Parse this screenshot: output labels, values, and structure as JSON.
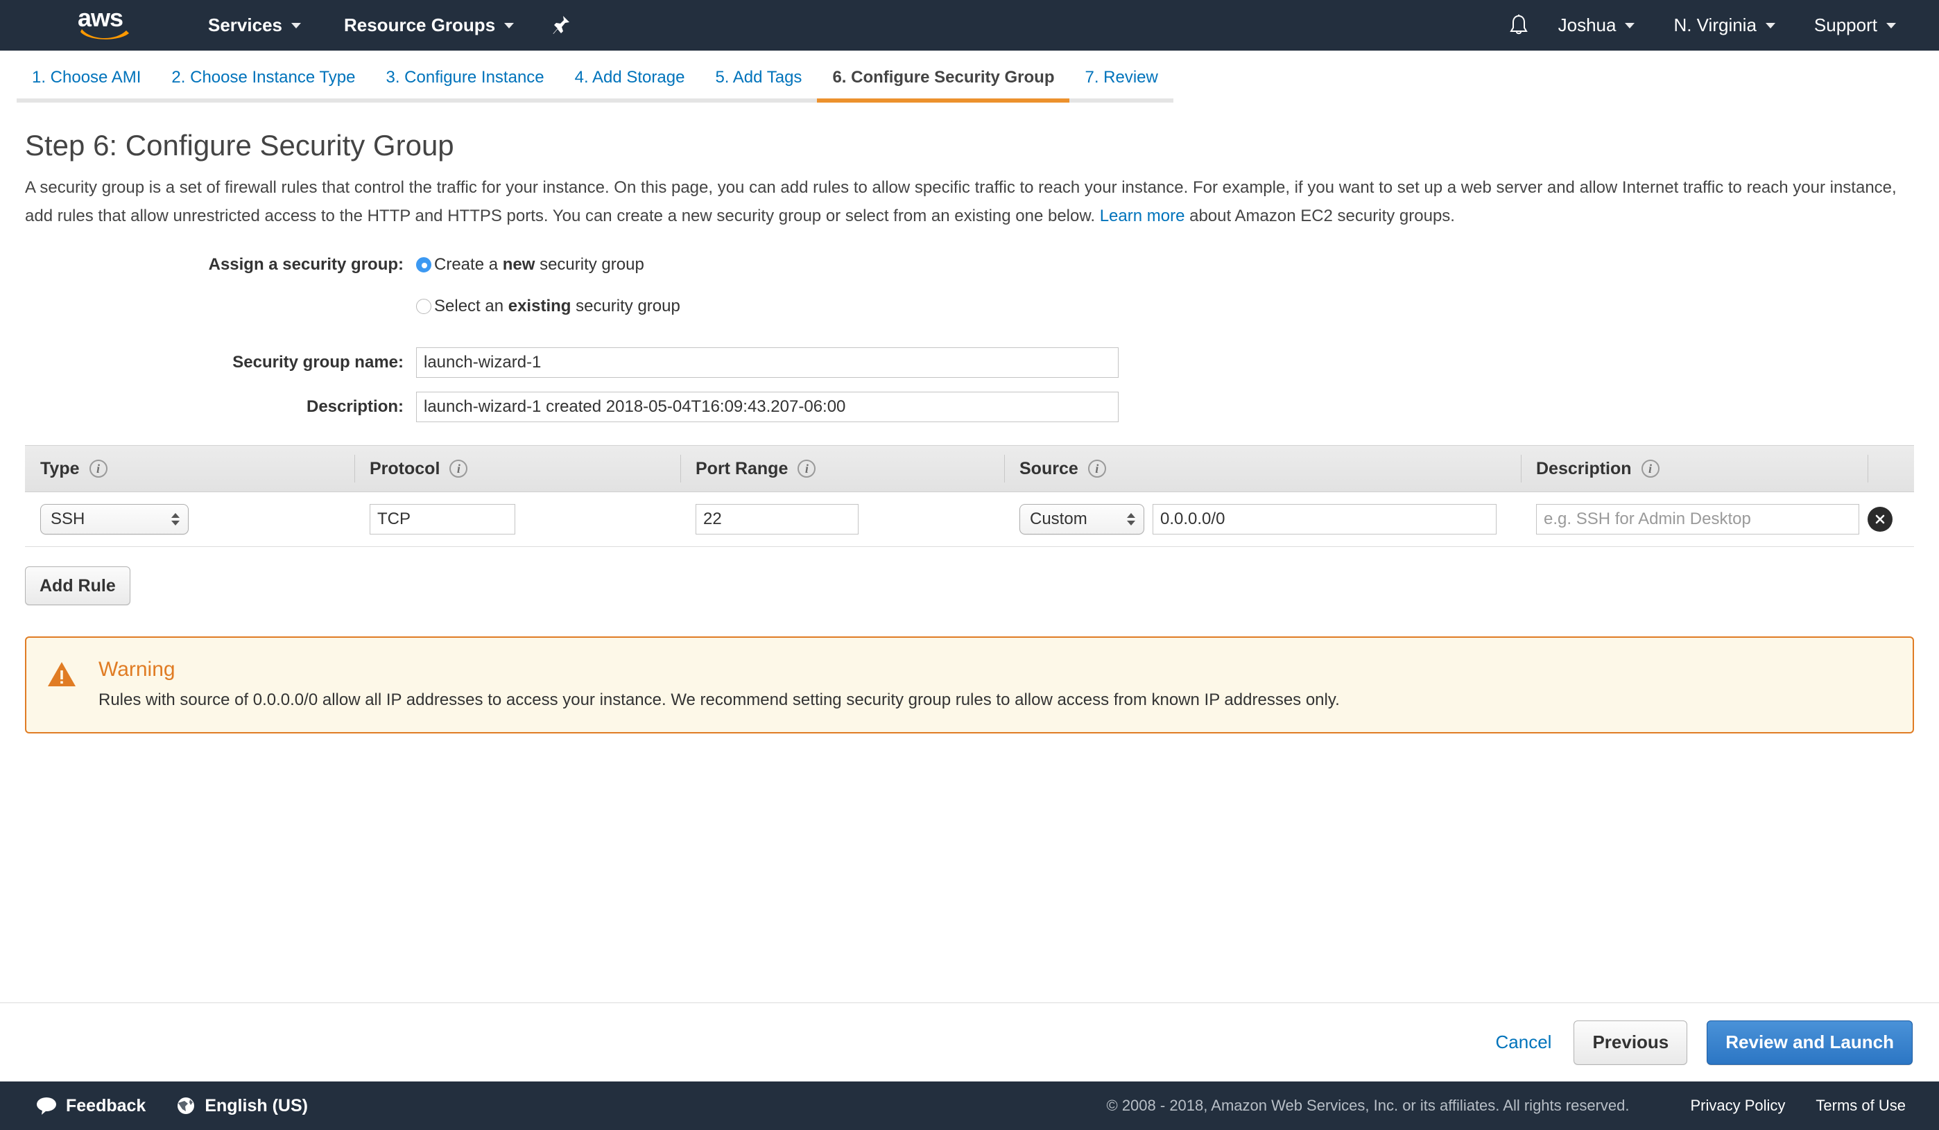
{
  "navbar": {
    "logo_text": "aws",
    "logo_name": "aws-logo",
    "services_label": "Services",
    "resource_groups_label": "Resource Groups",
    "pin_icon": "pin-icon",
    "bell_icon": "bell-notification-icon",
    "user_label": "Joshua",
    "region_label": "N. Virginia",
    "support_label": "Support"
  },
  "tabs": [
    {
      "label": "1. Choose AMI",
      "active": false
    },
    {
      "label": "2. Choose Instance Type",
      "active": false
    },
    {
      "label": "3. Configure Instance",
      "active": false
    },
    {
      "label": "4. Add Storage",
      "active": false
    },
    {
      "label": "5. Add Tags",
      "active": false
    },
    {
      "label": "6. Configure Security Group",
      "active": true
    },
    {
      "label": "7. Review",
      "active": false
    }
  ],
  "page": {
    "title": "Step 6: Configure Security Group",
    "desc_part1": "A security group is a set of firewall rules that control the traffic for your instance. On this page, you can add rules to allow specific traffic to reach your instance. For example, if you want to set up a web server and allow Internet traffic to reach your instance, add rules that allow unrestricted access to the HTTP and HTTPS ports. You can create a new security group or select from an existing one below. ",
    "desc_link": "Learn more",
    "desc_part2": " about Amazon EC2 security groups."
  },
  "form": {
    "assign_label": "Assign a security group:",
    "option_new_pre": "Create a ",
    "option_new_bold": "new",
    "option_new_post": " security group",
    "option_existing_pre": "Select an ",
    "option_existing_bold": "existing",
    "option_existing_post": " security group",
    "selected_option": "create_new",
    "sg_name_label": "Security group name:",
    "sg_name_value": "launch-wizard-1",
    "sg_desc_label": "Description:",
    "sg_desc_value": "launch-wizard-1 created 2018-05-04T16:09:43.207-06:00"
  },
  "rules_table": {
    "columns": [
      {
        "label": "Type",
        "info": "info-icon"
      },
      {
        "label": "Protocol",
        "info": "info-icon"
      },
      {
        "label": "Port Range",
        "info": "info-icon"
      },
      {
        "label": "Source",
        "info": "info-icon"
      },
      {
        "label": "Description",
        "info": "info-icon"
      }
    ],
    "info_glyph": "i",
    "rows": [
      {
        "type": "SSH",
        "protocol": "TCP",
        "port_range": "22",
        "source_kind": "Custom",
        "source_value": "0.0.0.0/0",
        "description_placeholder": "e.g. SSH for Admin Desktop",
        "description_value": "",
        "delete_icon": "delete-rule-icon"
      }
    ],
    "add_rule_label": "Add Rule"
  },
  "warning": {
    "icon": "warning-triangle-icon",
    "title": "Warning",
    "text": "Rules with source of 0.0.0.0/0 allow all IP addresses to access your instance. We recommend setting security group rules to allow access from known IP addresses only."
  },
  "actions": {
    "cancel_label": "Cancel",
    "previous_label": "Previous",
    "review_label": "Review and Launch"
  },
  "footer": {
    "feedback_label": "Feedback",
    "feedback_icon": "speech-bubble-icon",
    "language_label": "English (US)",
    "language_icon": "globe-icon",
    "copyright": "© 2008 - 2018, Amazon Web Services, Inc. or its affiliates. All rights reserved.",
    "privacy_label": "Privacy Policy",
    "terms_label": "Terms of Use"
  },
  "colors": {
    "nav_bg": "#232f3e",
    "accent_orange": "#ec912d",
    "link_blue": "#0073bb",
    "radio_blue": "#3c99f2",
    "warning_border": "#e07c24",
    "warning_bg": "#fdf8e8",
    "primary_button": "#2c76c4"
  }
}
